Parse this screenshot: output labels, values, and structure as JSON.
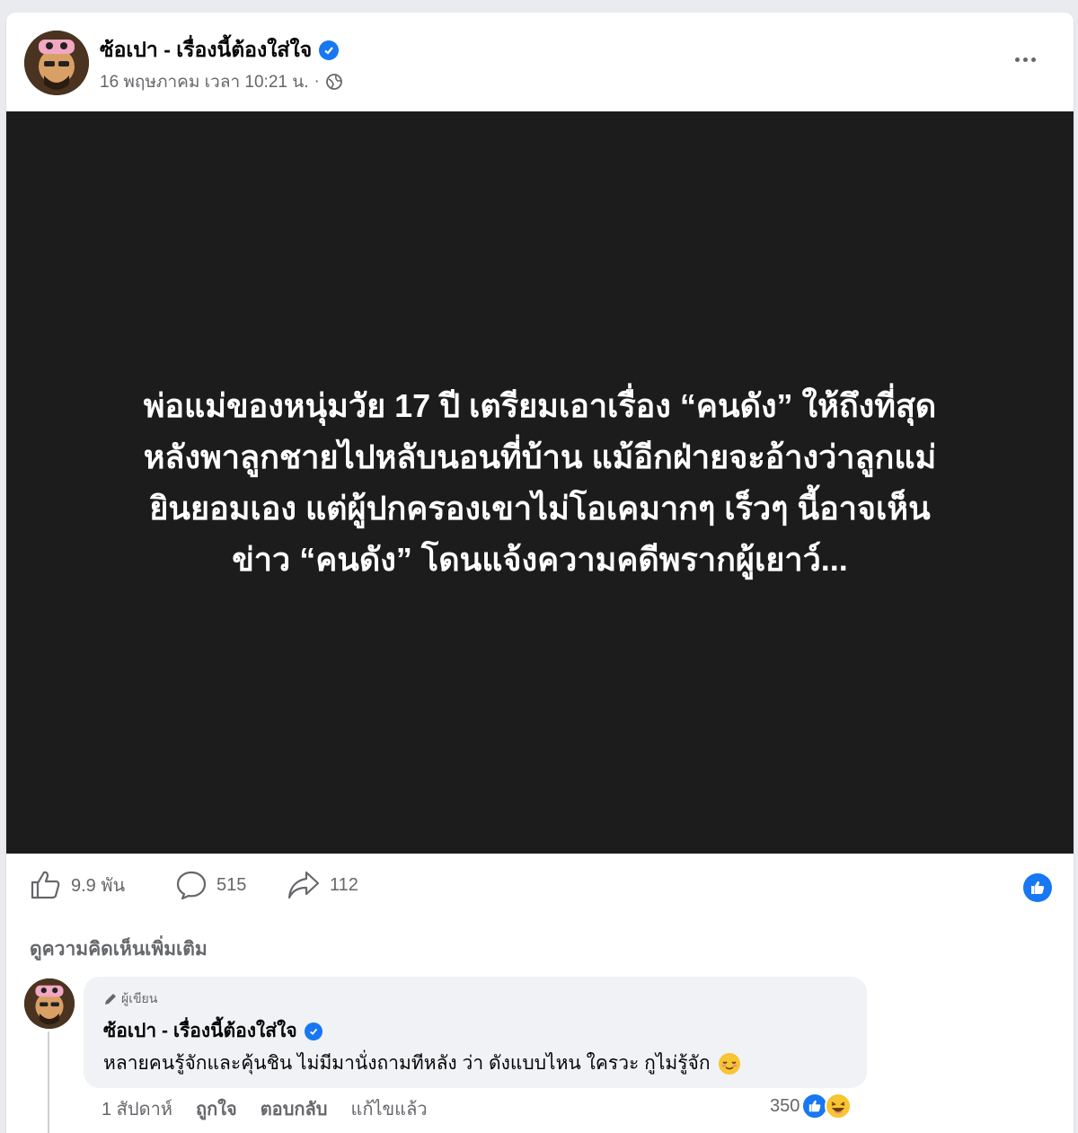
{
  "post": {
    "page_name": "ซ้อเปา - เรื่องนี้ต้องใส่ใจ",
    "date": "16 พฤษภาคม เวลา 10:21 น.",
    "separator": "·",
    "headline_lines": [
      "พ่อแม่ของหนุ่มวัย 17 ปี เตรียมเอาเรื่อง “คนดัง” ให้ถึงที่สุด",
      "หลังพาลูกชายไปหลับนอนที่บ้าน แม้อีกฝ่ายจะอ้างว่าลูกแม่",
      "ยินยอมเอง แต่ผู้ปกครองเขาไม่โอเคมากๆ เร็วๆ นี้อาจเห็น",
      "ข่าว “คนดัง” โดนแจ้งความคดีพรากผู้เยาว์..."
    ]
  },
  "stats": {
    "likes": "9.9 พัน",
    "comments": "515",
    "shares": "112"
  },
  "view_more_comments": "ดูความคิดเห็นเพิ่มเติม",
  "comment": {
    "badge": "ผู้เขียน",
    "author": "ซ้อเปา - เรื่องนี้ต้องใส่ใจ",
    "text": "หลายคนรู้จักและคุ้นชิน ไม่มีมานั่งถามทีหลัง ว่า ดังแบบไหน ใครวะ กูไม่รู้จัก",
    "time": "1 สัปดาห์",
    "like_label": "ถูกใจ",
    "reply_label": "ตอบกลับ",
    "edited_label": "แก้ไขแล้ว",
    "reaction_count": "350"
  },
  "colors": {
    "brand_blue": "#1877f2",
    "image_bg": "#1c1c1c",
    "secondary_text": "#65676b",
    "bubble_bg": "#f0f2f5"
  },
  "icons": [
    "verified-icon",
    "globe-icon",
    "more-icon",
    "like-icon",
    "comment-icon",
    "share-icon",
    "like-reaction-icon",
    "haha-reaction-icon",
    "pencil-icon",
    "relieved-emoji-icon"
  ]
}
